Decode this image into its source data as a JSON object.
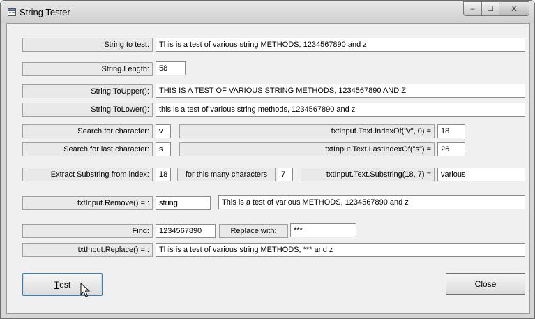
{
  "window": {
    "title": "String Tester",
    "caption": {
      "minimize": "–",
      "maximize": "☐",
      "close": "X"
    }
  },
  "form": {
    "string_to_test": {
      "label": "String to test:",
      "value": "This is a test of various string METHODS, 1234567890 and z"
    },
    "length": {
      "label": "String.Length:",
      "value": "58"
    },
    "to_upper": {
      "label": "String.ToUpper():",
      "value": "THIS IS A TEST OF VARIOUS STRING METHODS, 1234567890 AND Z"
    },
    "to_lower": {
      "label": "String.ToLower():",
      "value": "this is a test of various string methods, 1234567890 and z"
    },
    "search_char": {
      "label": "Search for character:",
      "value": "v",
      "result_label": "txtInput.Text.IndexOf(\"v\", 0) =",
      "result": "18"
    },
    "search_last": {
      "label": "Search for last character:",
      "value": "s",
      "result_label": "txtInput.Text.LastIndexOf(\"s\") =",
      "result": "26"
    },
    "substring": {
      "label": "Extract Substring from index:",
      "index": "18",
      "count_label": "for this many characters",
      "count": "7",
      "result_label": "txtInput.Text.Substring(18, 7) =",
      "result": "various"
    },
    "remove": {
      "label": "txtInput.Remove() = :",
      "word": "string",
      "result": "This is a test of various  METHODS, 1234567890 and z"
    },
    "find": {
      "label": "Find:",
      "value": "1234567890",
      "replace_label": "Replace with:",
      "replace_value": "***"
    },
    "replace": {
      "label": "txtInput.Replace() = :",
      "result": "This is a test of various string METHODS, *** and z"
    }
  },
  "buttons": {
    "test_mnemonic": "T",
    "test_rest": "est",
    "close_mnemonic": "C",
    "close_rest": "lose"
  }
}
